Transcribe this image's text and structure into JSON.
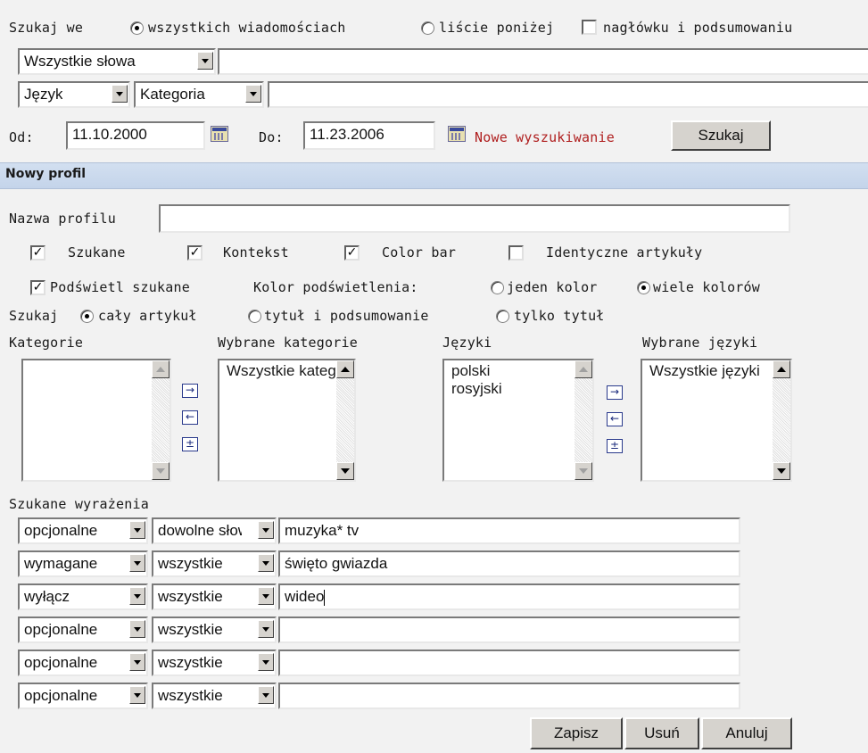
{
  "search": {
    "search_in_label": "Szukaj we",
    "opt_all": "wszystkich wiadomościach",
    "opt_list": "liście poniżej",
    "opt_headers": "nagłówku i podsumowaniu",
    "word_mode": "Wszystkie słowa",
    "words_value": "",
    "language": "Język",
    "category": "Kategoria",
    "category_value": "",
    "from_label": "Od:",
    "from_date": "11.10.2000",
    "to_label": "Do:",
    "to_date": "11.23.2006",
    "new_search_link": "Nowe wyszukiwanie",
    "search_button": "Szukaj"
  },
  "profile": {
    "section_title": "Nowy profil",
    "name_label": "Nazwa profilu",
    "name_value": "",
    "chk_searched": "Szukane",
    "chk_context": "Kontekst",
    "chk_colorbar": "Color bar",
    "chk_identical": "Identyczne artykuły",
    "chk_highlight": "Podświetl szukane",
    "highlight_color_label": "Kolor podświetlenia:",
    "opt_one_color": "jeden kolor",
    "opt_many_colors": "wiele kolorów",
    "scope_label": "Szukaj",
    "scope_whole": "cały artykuł",
    "scope_title_summary": "tytuł i podsumowanie",
    "scope_title_only": "tylko tytuł",
    "categories_label": "Kategorie",
    "selected_categories_label": "Wybrane kategorie",
    "selected_categories": [
      "Wszystkie kategorie"
    ],
    "languages_label": "Języki",
    "languages": [
      "polski",
      "rosyjski"
    ],
    "selected_languages_label": "Wybrane języki",
    "selected_languages": [
      "Wszystkie języki"
    ],
    "arrow_add": "→",
    "arrow_remove": "←",
    "arrow_all": "±",
    "expressions_label": "Szukane wyrażenia",
    "expressions": [
      {
        "mode": "opcjonalne",
        "match": "dowolne słowo",
        "text": "muzyka* tv"
      },
      {
        "mode": "wymagane",
        "match": "wszystkie",
        "text": "święto gwiazda"
      },
      {
        "mode": "wyłącz",
        "match": "wszystkie",
        "text": "wideo"
      },
      {
        "mode": "opcjonalne",
        "match": "wszystkie",
        "text": ""
      },
      {
        "mode": "opcjonalne",
        "match": "wszystkie",
        "text": ""
      },
      {
        "mode": "opcjonalne",
        "match": "wszystkie",
        "text": ""
      }
    ],
    "save_button": "Zapisz",
    "delete_button": "Usuń",
    "cancel_button": "Anuluj"
  }
}
